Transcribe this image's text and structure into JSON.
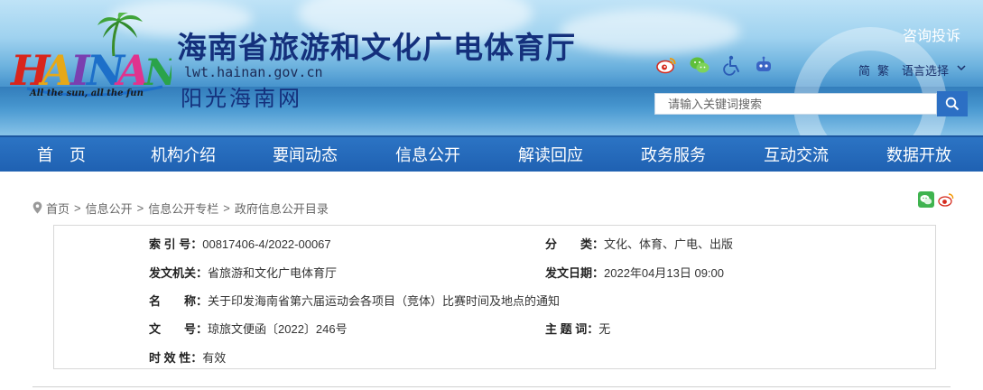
{
  "header": {
    "logo_text": "HAINAN",
    "logo_tagline": "All the sun, all the fun",
    "site_title": "海南省旅游和文化广电体育厅",
    "site_url": "lwt.hainan.gov.cn",
    "site_subtitle": "阳光海南网",
    "consult_link": "咨询投诉",
    "lang_simplified": "简",
    "lang_traditional": "繁",
    "lang_select": "语言选择",
    "search_placeholder": "请输入关键词搜索",
    "colors": {
      "title": "#14307c",
      "search_button": "#2c6fc4",
      "nav": "#2168b8"
    }
  },
  "social_icons": [
    "weibo-icon",
    "wechat-icon",
    "accessibility-icon",
    "robot-icon"
  ],
  "nav": {
    "items": [
      "首　页",
      "机构介绍",
      "要闻动态",
      "信息公开",
      "解读回应",
      "政务服务",
      "互动交流",
      "数据开放"
    ]
  },
  "breadcrumb": {
    "items": [
      "首页",
      "信息公开",
      "信息公开专栏"
    ],
    "separator": ">",
    "current": "政府信息公开目录"
  },
  "share_icons": [
    "wechat-share-icon",
    "weibo-share-icon"
  ],
  "document": {
    "index_no_label": "索 引 号：",
    "index_no": "00817406-4/2022-00067",
    "category_label": "分　　类：",
    "category": "文化、体育、广电、出版",
    "issuer_label": "发文机关：",
    "issuer": "省旅游和文化广电体育厅",
    "date_label": "发文日期：",
    "date": "2022年04月13日 09:00",
    "name_label": "名　　称：",
    "name": "关于印发海南省第六届运动会各项目（竞体）比赛时间及地点的通知",
    "doc_no_label": "文　　号：",
    "doc_no": "琼旅文便函〔2022〕246号",
    "keywords_label": "主 题 词：",
    "keywords": "无",
    "validity_label": "时 效 性：",
    "validity": "有效"
  }
}
